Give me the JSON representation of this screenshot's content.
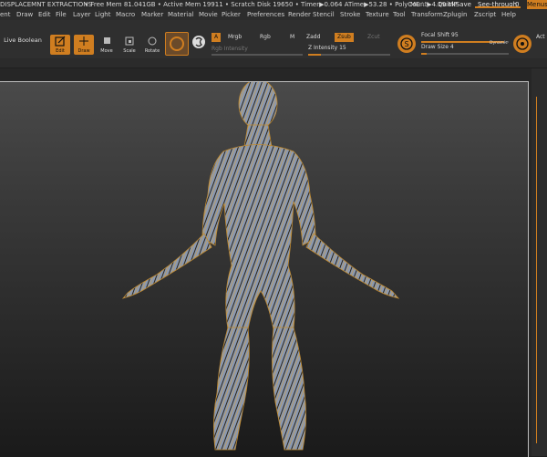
{
  "titlebar": {
    "doc": "DISPLACEMNT EXTRACTIONS",
    "stats": "• Free Mem 81.041GB • Active Mem 19911 • Scratch Disk 19650 • Timer▶0.064 ATime▶53.28 • PolyCount▶4.19 MP",
    "me": "ME",
    "ac": "AC",
    "quicksave": "QuickSave",
    "see_through_label": "See-through",
    "see_through_value": "0",
    "menus": "Menus"
  },
  "menu": [
    "ent",
    "Draw",
    "Edit",
    "File",
    "Layer",
    "Light",
    "Macro",
    "Marker",
    "Material",
    "Movie",
    "Picker",
    "Preferences",
    "Render",
    "Stencil",
    "Stroke",
    "Texture",
    "Tool",
    "Transform",
    "Zplugin",
    "Zscript",
    "Help"
  ],
  "toolbar": {
    "live_boolean": "Live Boolean",
    "edit": "Edit",
    "draw": "Draw",
    "move": "Move",
    "scale": "Scale",
    "rotate": "Rotate",
    "a": "A",
    "mrgb": "Mrgb",
    "rgb": "Rgb",
    "m": "M",
    "zadd": "Zadd",
    "zsub": "Zsub",
    "zcut": "Zcut",
    "rgb_intensity": "Rgb Intensity",
    "z_intensity_label": "Z Intensity",
    "z_intensity_value": "15",
    "z_intensity_fraction": 0.15,
    "focal_label": "Focal Shift",
    "focal_value": "95",
    "focal_fraction": 0.95,
    "draw_size_label": "Draw Size",
    "draw_size_value": "4",
    "dynamic": "Dynamic",
    "act": "Act"
  },
  "colors": {
    "accent": "#d07e20",
    "viewport_border": "#bdbdbd"
  }
}
